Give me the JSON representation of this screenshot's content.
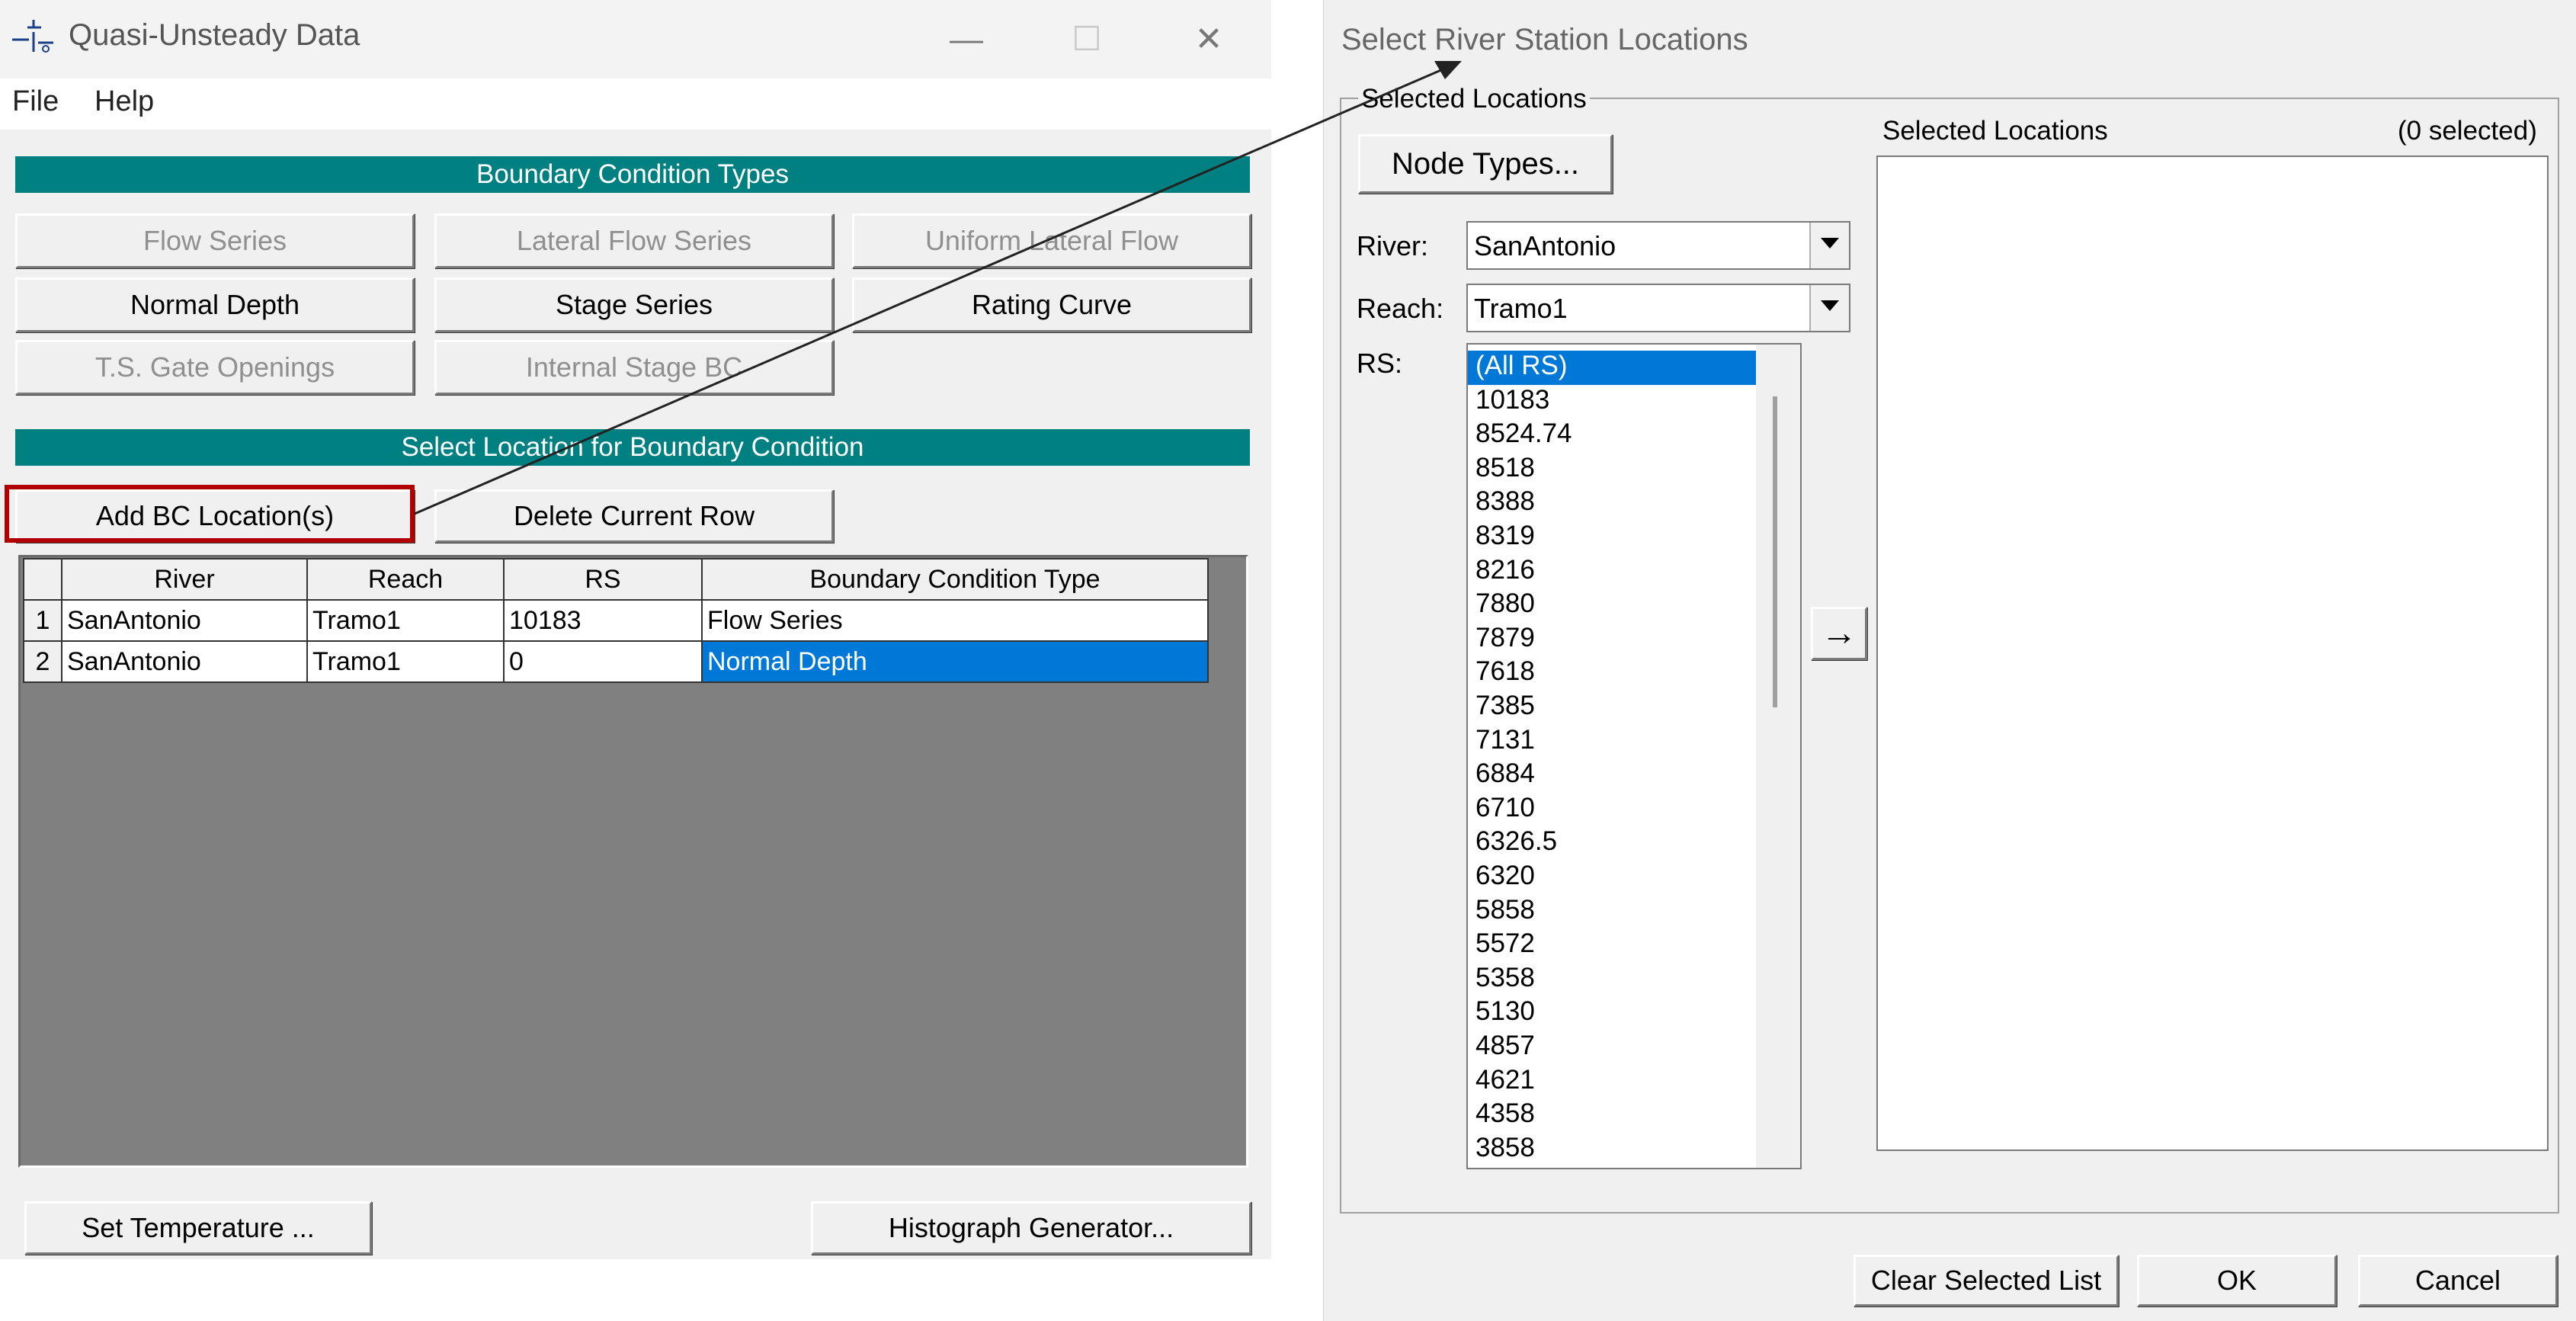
{
  "left_window": {
    "title": "Quasi-Unsteady Data",
    "controls": {
      "minimize": "—",
      "maximize": "☐",
      "close": "✕"
    },
    "menu": [
      "File",
      "Help"
    ],
    "bc_types_header": "Boundary Condition Types",
    "bc_buttons": {
      "flow_series": "Flow Series",
      "lateral_flow_series": "Lateral Flow Series",
      "uniform_lateral_flow": "Uniform Lateral Flow",
      "normal_depth": "Normal Depth",
      "stage_series": "Stage Series",
      "rating_curve": "Rating Curve",
      "ts_gate_openings": "T.S. Gate Openings",
      "internal_stage_bc": "Internal Stage BC"
    },
    "location_header": "Select Location for Boundary Condition",
    "add_bc_location": "Add BC Location(s)",
    "delete_current_row": "Delete Current Row",
    "table": {
      "columns": [
        "River",
        "Reach",
        "RS",
        "Boundary Condition Type"
      ],
      "rows": [
        {
          "num": "1",
          "river": "SanAntonio",
          "reach": "Tramo1",
          "rs": "10183",
          "bc_type": "Flow Series"
        },
        {
          "num": "2",
          "river": "SanAntonio",
          "reach": "Tramo1",
          "rs": "0",
          "bc_type": "Normal Depth"
        }
      ]
    },
    "set_temperature": "Set Temperature ...",
    "histograph_generator": "Histograph Generator..."
  },
  "right_window": {
    "title": "Select River Station Locations",
    "group_label": "Selected Locations",
    "node_types_button": "Node Types...",
    "river_label": "River:",
    "river_value": "SanAntonio",
    "reach_label": "Reach:",
    "reach_value": "Tramo1",
    "rs_label": "RS:",
    "rs_items": [
      "(All RS)",
      "10183",
      "8524.74",
      "8518",
      "8388",
      "8319",
      "8216",
      "7880",
      "7879",
      "7618",
      "7385",
      "7131",
      "6884",
      "6710",
      "6326.5",
      "6320",
      "5858",
      "5572",
      "5358",
      "5130",
      "4857",
      "4621",
      "4358",
      "3858"
    ],
    "rs_selected_index": 0,
    "selected_locations_label": "Selected Locations",
    "selected_count": "(0 selected)",
    "arrow_button": "→",
    "clear_selected_list": "Clear Selected List",
    "ok": "OK",
    "cancel": "Cancel"
  },
  "colors": {
    "teal_header": "#008080",
    "selection_blue": "#0078d7",
    "highlight_red": "#b00000",
    "grid_background": "#808080"
  }
}
